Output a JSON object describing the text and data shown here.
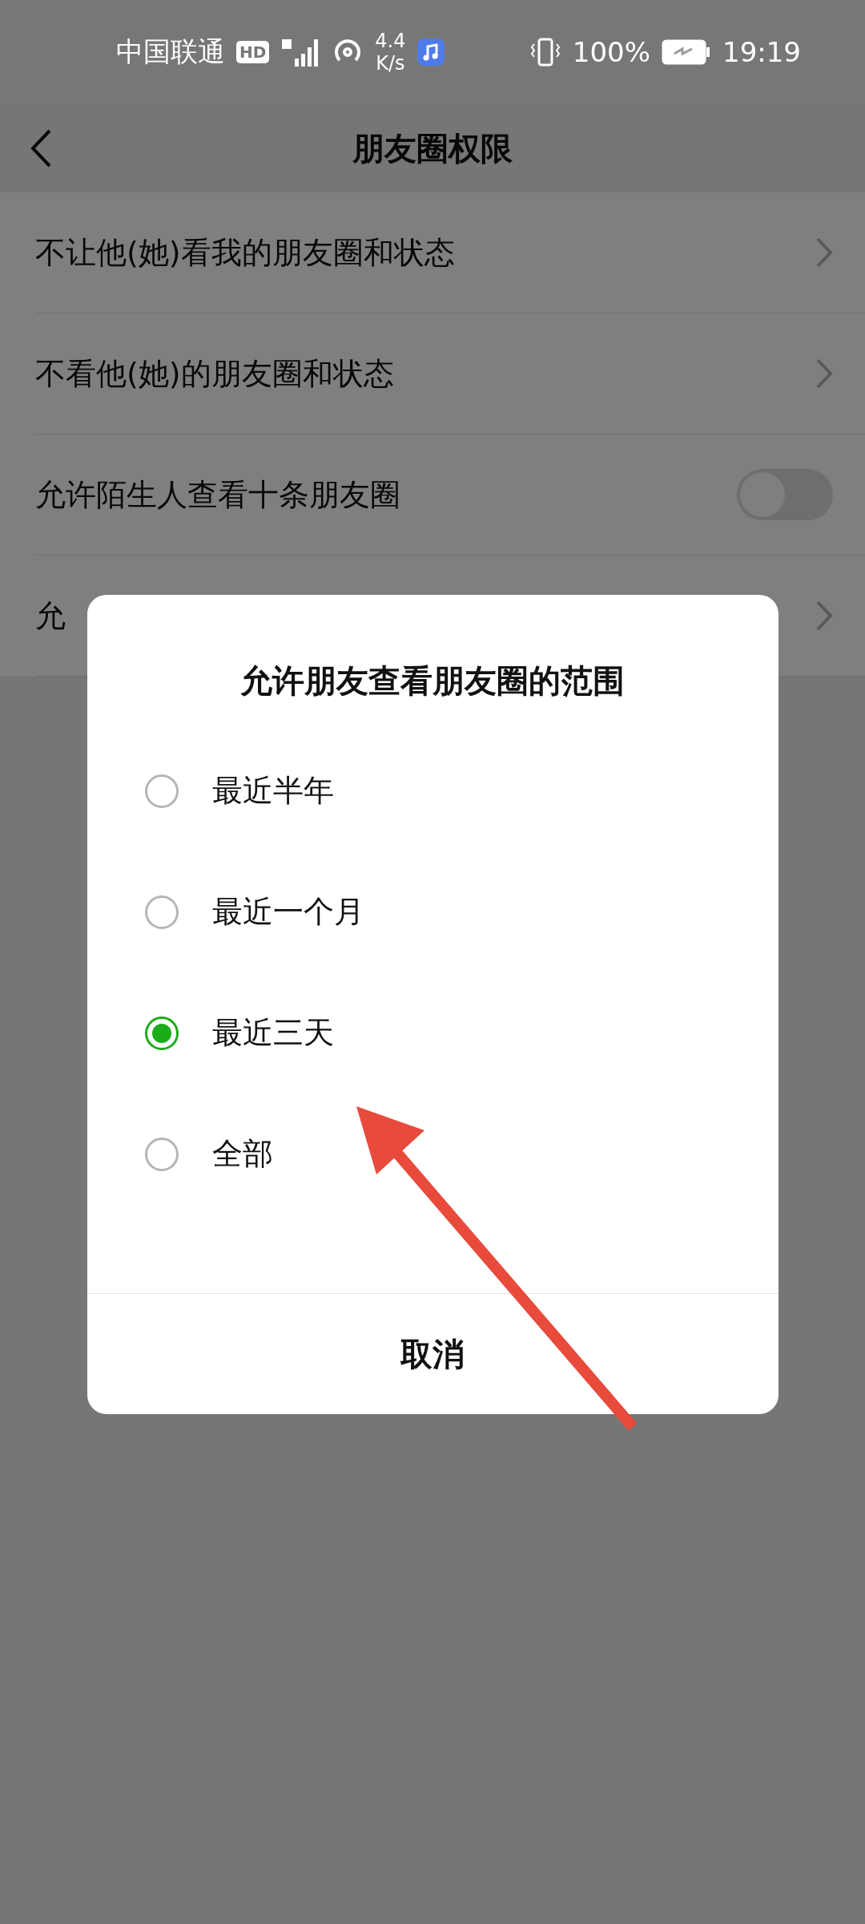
{
  "status_bar": {
    "carrier": "中国联通",
    "hd": "HD",
    "net_speed": "4.4",
    "net_unit": "K/s",
    "battery": "100%",
    "time": "19:19"
  },
  "header": {
    "title": "朋友圈权限"
  },
  "settings": [
    {
      "kind": "link",
      "label": "不让他(她)看我的朋友圈和状态"
    },
    {
      "kind": "link",
      "label": "不看他(她)的朋友圈和状态"
    },
    {
      "kind": "toggle",
      "label": "允许陌生人查看十条朋友圈",
      "on": false
    },
    {
      "kind": "link",
      "label": "允"
    }
  ],
  "dialog": {
    "title": "允许朋友查看朋友圈的范围",
    "options": [
      {
        "label": "最近半年",
        "selected": false
      },
      {
        "label": "最近一个月",
        "selected": false
      },
      {
        "label": "最近三天",
        "selected": true
      },
      {
        "label": "全部",
        "selected": false
      }
    ],
    "cancel": "取消"
  }
}
